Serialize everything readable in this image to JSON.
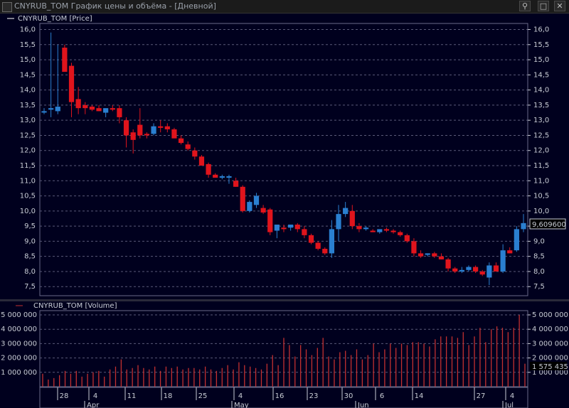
{
  "window": {
    "title": "CNYRUB_TOM График цены и объёма - [Дневной]",
    "buttons": {
      "pin": "⚲",
      "restore": "□",
      "close": "✕"
    }
  },
  "colors": {
    "background": "#000000",
    "panel": "#00001e",
    "grid": "#5a5a78",
    "up": "#2a7fd0",
    "down": "#e0141c",
    "volume": "#c43030",
    "text": "#c8ccd4"
  },
  "price_panel": {
    "legend": "CNYRUB_TOM [Price]",
    "last_value_label": "9,609600"
  },
  "volume_panel": {
    "legend": "CNYRUB_TOM [Volume]",
    "last_value_label": "1 575 435"
  },
  "chart_data": [
    {
      "type": "candlestick",
      "title": "CNYRUB_TOM [Price]",
      "yticks": [
        "16,0",
        "15,5",
        "15,0",
        "14,5",
        "14,0",
        "13,5",
        "13,0",
        "12,5",
        "12,0",
        "11,5",
        "11,0",
        "10,5",
        "10,0",
        "9,5",
        "9,0",
        "8,5",
        "8,0",
        "7,5"
      ],
      "ylim": [
        7.2,
        16.2
      ],
      "grid": true,
      "xtick_days": [
        "28",
        "4",
        "11",
        "18",
        "25",
        "4",
        "16",
        "23",
        "30",
        "6",
        "14",
        "27",
        "4"
      ],
      "xtick_months": [
        "Apr",
        "May",
        "Jun",
        "Jul"
      ],
      "ohlc": [
        [
          13.3,
          13.4,
          13.2,
          13.3
        ],
        [
          13.35,
          15.9,
          13.1,
          13.4
        ],
        [
          13.3,
          15.5,
          13.2,
          13.45
        ],
        [
          15.4,
          15.5,
          14.9,
          14.6
        ],
        [
          14.8,
          14.9,
          13.1,
          13.6
        ],
        [
          13.7,
          14.1,
          13.2,
          13.4
        ],
        [
          13.5,
          13.6,
          13.2,
          13.4
        ],
        [
          13.45,
          13.5,
          13.3,
          13.35
        ],
        [
          13.4,
          13.5,
          13.3,
          13.3
        ],
        [
          13.25,
          13.35,
          13.1,
          13.4
        ],
        [
          13.4,
          13.5,
          13.3,
          13.35
        ],
        [
          13.4,
          13.5,
          12.9,
          13.1
        ],
        [
          13.0,
          13.1,
          12.1,
          12.5
        ],
        [
          12.6,
          12.7,
          11.9,
          12.35
        ],
        [
          12.85,
          13.4,
          12.4,
          12.5
        ],
        [
          12.55,
          12.6,
          12.4,
          12.5
        ],
        [
          12.55,
          12.9,
          12.5,
          12.8
        ],
        [
          12.8,
          13.0,
          12.6,
          12.75
        ],
        [
          12.8,
          12.9,
          12.6,
          12.7
        ],
        [
          12.7,
          12.75,
          12.5,
          12.4
        ],
        [
          12.4,
          12.5,
          12.2,
          12.25
        ],
        [
          12.2,
          12.3,
          12.0,
          12.05
        ],
        [
          12.0,
          12.1,
          11.7,
          11.8
        ],
        [
          11.8,
          11.85,
          11.5,
          11.5
        ],
        [
          11.55,
          11.6,
          11.1,
          11.2
        ],
        [
          11.2,
          11.25,
          11.1,
          11.1
        ],
        [
          11.1,
          11.2,
          11.05,
          11.15
        ],
        [
          11.1,
          11.2,
          10.9,
          11.15
        ],
        [
          11.0,
          11.1,
          10.8,
          10.8
        ],
        [
          10.8,
          10.85,
          9.95,
          10.0
        ],
        [
          10.0,
          10.35,
          9.95,
          10.3
        ],
        [
          10.2,
          10.6,
          10.1,
          10.5
        ],
        [
          10.1,
          10.2,
          9.9,
          9.95
        ],
        [
          10.05,
          10.1,
          9.2,
          9.3
        ],
        [
          9.35,
          9.5,
          9.1,
          9.55
        ],
        [
          9.45,
          9.55,
          9.3,
          9.4
        ],
        [
          9.45,
          9.5,
          9.35,
          9.55
        ],
        [
          9.55,
          9.6,
          9.3,
          9.4
        ],
        [
          9.4,
          9.5,
          9.1,
          9.2
        ],
        [
          9.2,
          9.25,
          8.9,
          8.95
        ],
        [
          8.95,
          9.0,
          8.7,
          8.75
        ],
        [
          8.75,
          8.8,
          8.55,
          8.6
        ],
        [
          8.6,
          9.7,
          8.45,
          9.4
        ],
        [
          9.4,
          10.2,
          9.0,
          9.9
        ],
        [
          9.9,
          10.3,
          9.8,
          10.1
        ],
        [
          10.0,
          10.2,
          9.4,
          9.5
        ],
        [
          9.5,
          9.6,
          9.3,
          9.4
        ],
        [
          9.4,
          9.5,
          9.35,
          9.45
        ],
        [
          9.35,
          9.4,
          9.3,
          9.3
        ],
        [
          9.3,
          9.35,
          9.25,
          9.4
        ],
        [
          9.4,
          9.45,
          9.3,
          9.35
        ],
        [
          9.35,
          9.4,
          9.25,
          9.3
        ],
        [
          9.3,
          9.35,
          9.15,
          9.2
        ],
        [
          9.2,
          9.25,
          8.95,
          9.0
        ],
        [
          9.0,
          9.1,
          8.5,
          8.6
        ],
        [
          8.6,
          8.7,
          8.45,
          8.5
        ],
        [
          8.55,
          8.6,
          8.5,
          8.6
        ],
        [
          8.6,
          8.65,
          8.45,
          8.5
        ],
        [
          8.5,
          8.6,
          8.4,
          8.4
        ],
        [
          8.4,
          8.45,
          8.0,
          8.1
        ],
        [
          8.1,
          8.15,
          7.95,
          8.0
        ],
        [
          8.0,
          8.15,
          7.95,
          8.05
        ],
        [
          8.05,
          8.2,
          8.0,
          8.15
        ],
        [
          8.15,
          8.2,
          7.95,
          8.0
        ],
        [
          8.0,
          8.05,
          7.85,
          7.9
        ],
        [
          7.8,
          8.3,
          7.55,
          8.2
        ],
        [
          8.2,
          8.3,
          8.0,
          8.0
        ],
        [
          8.0,
          8.9,
          7.95,
          8.7
        ],
        [
          8.7,
          8.8,
          8.6,
          8.6
        ],
        [
          8.7,
          9.5,
          8.65,
          9.4
        ],
        [
          9.4,
          9.9,
          9.3,
          9.6
        ]
      ]
    },
    {
      "type": "bar",
      "title": "CNYRUB_TOM [Volume]",
      "yticks": [
        "5 000 000",
        "4 000 000",
        "3 000 000",
        "2 000 000",
        "1 000 000"
      ],
      "ylim": [
        0,
        5000000
      ],
      "grid": true,
      "values": [
        900000,
        500000,
        600000,
        800000,
        1100000,
        900000,
        1100000,
        700000,
        900000,
        1000000,
        1100000,
        700000,
        1200000,
        1400000,
        1900000,
        1200000,
        1300000,
        1500000,
        1300000,
        1200000,
        1400000,
        1100000,
        1400000,
        1300000,
        1400000,
        1200000,
        1300000,
        1300000,
        1200000,
        1400000,
        1200000,
        1100000,
        1300000,
        1500000,
        1200000,
        1700000,
        1500000,
        1400000,
        1300000,
        1200000,
        1600000,
        2200000,
        1500000,
        3400000,
        2900000,
        2100000,
        2900000,
        2600000,
        2200000,
        2700000,
        3400000,
        2100000,
        1900000,
        2400000,
        2500000,
        2200000,
        2600000,
        1900000,
        2200000,
        3000000,
        2400000,
        2600000,
        3000000,
        2700000,
        3000000,
        2900000,
        3100000,
        3100000,
        3000000,
        2800000,
        3300000,
        3500000,
        3500000,
        3500000,
        3400000,
        3800000,
        2900000,
        3500000,
        4100000,
        3100000,
        4000000,
        4200000,
        4100000,
        3800000,
        4100000,
        5000000,
        1600000
      ]
    }
  ]
}
